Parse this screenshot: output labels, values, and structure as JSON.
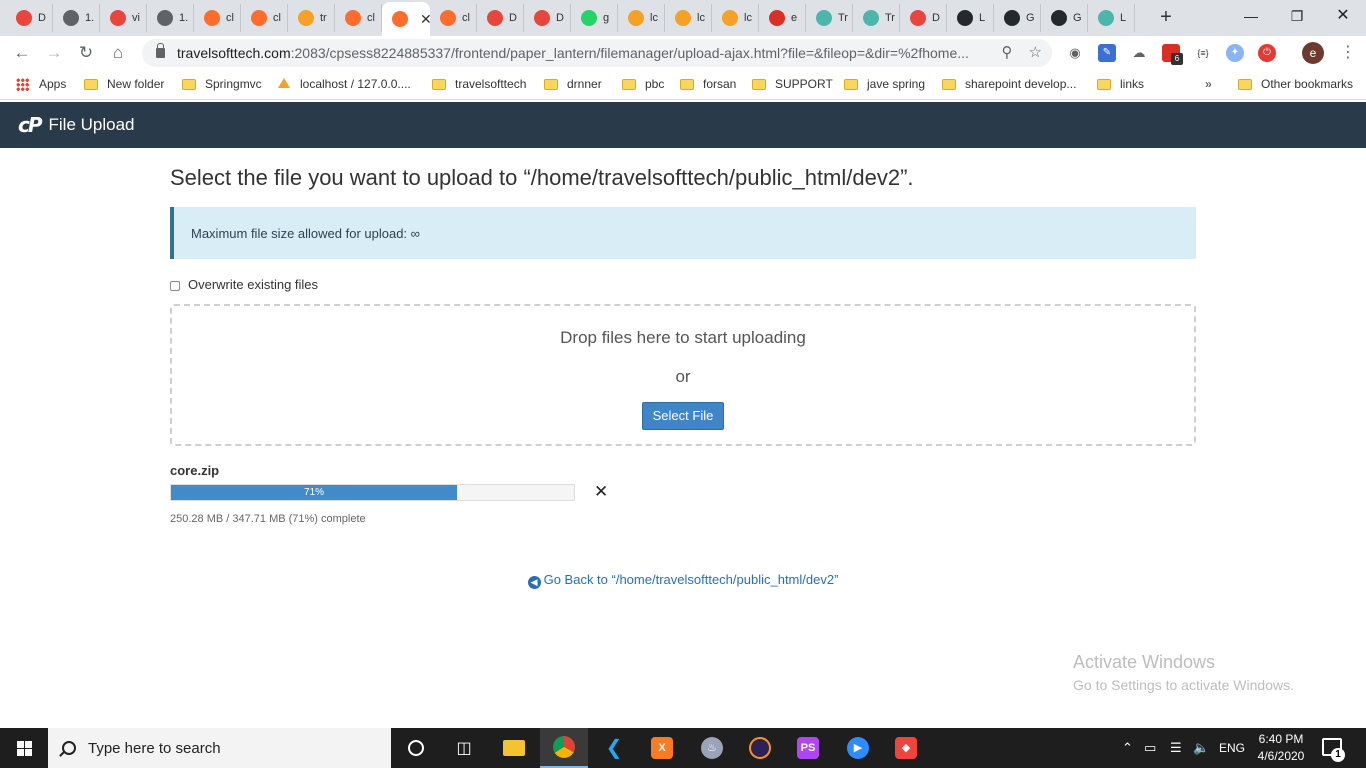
{
  "browser": {
    "tabs": [
      {
        "label": "D",
        "icon": "maps-pin-icon",
        "color": "#e8453c"
      },
      {
        "label": "1.",
        "icon": "globe-icon",
        "color": "#5f6368"
      },
      {
        "label": "vi",
        "icon": "maps-pin-icon",
        "color": "#e8453c"
      },
      {
        "label": "1.",
        "icon": "globe-icon",
        "color": "#5f6368"
      },
      {
        "label": "cl",
        "icon": "cpanel-icon",
        "color": "#ff6c2c"
      },
      {
        "label": "cl",
        "icon": "cpanel-icon",
        "color": "#ff6c2c"
      },
      {
        "label": "tr",
        "icon": "phpmyadmin-icon",
        "color": "#f4a125"
      },
      {
        "label": "cl",
        "icon": "cpanel-icon",
        "color": "#ff6c2c"
      },
      {
        "label": "",
        "icon": "cpanel-icon",
        "color": "#ff6c2c",
        "active": true
      },
      {
        "label": "cl",
        "icon": "cpanel-icon",
        "color": "#ff6c2c"
      },
      {
        "label": "D",
        "icon": "maps-pin-icon",
        "color": "#e8453c"
      },
      {
        "label": "D",
        "icon": "maps-pin-icon",
        "color": "#e8453c"
      },
      {
        "label": "g",
        "icon": "whatsapp-icon",
        "color": "#25d366"
      },
      {
        "label": "lc",
        "icon": "phpmyadmin-icon",
        "color": "#f4a125"
      },
      {
        "label": "lc",
        "icon": "phpmyadmin-icon",
        "color": "#f4a125"
      },
      {
        "label": "lc",
        "icon": "phpmyadmin-icon",
        "color": "#f4a125"
      },
      {
        "label": "e",
        "icon": "gmail-icon",
        "color": "#d93025"
      },
      {
        "label": "Tr",
        "icon": "translate-icon",
        "color": "#4db6ac"
      },
      {
        "label": "Tr",
        "icon": "translate-icon",
        "color": "#4db6ac"
      },
      {
        "label": "D",
        "icon": "maps-pin-icon",
        "color": "#e8453c"
      },
      {
        "label": "L",
        "icon": "github-icon",
        "color": "#24292e"
      },
      {
        "label": "G",
        "icon": "github-icon",
        "color": "#24292e"
      },
      {
        "label": "G",
        "icon": "github-icon",
        "color": "#24292e"
      },
      {
        "label": "L",
        "icon": "translate-icon",
        "color": "#4db6ac"
      }
    ],
    "url_host": "travelsofttech.com",
    "url_rest": ":2083/cpsess8224885337/frontend/paper_lantern/filemanager/upload-ajax.html?file=&fileop=&dir=%2fhome...",
    "profile_initial": "e",
    "ext_badge": "6",
    "ext_json_label": "{≡}",
    "bookmarks": [
      {
        "label": "Apps",
        "type": "apps"
      },
      {
        "label": "New folder",
        "type": "folder"
      },
      {
        "label": "Springmvc",
        "type": "folder"
      },
      {
        "label": "localhost / 127.0.0....",
        "type": "pma"
      },
      {
        "label": "travelsofttech",
        "type": "folder"
      },
      {
        "label": "drnner",
        "type": "folder"
      },
      {
        "label": "pbc",
        "type": "folder"
      },
      {
        "label": "forsan",
        "type": "folder"
      },
      {
        "label": "SUPPORT",
        "type": "folder"
      },
      {
        "label": "jave spring",
        "type": "folder"
      },
      {
        "label": "sharepoint develop...",
        "type": "folder"
      },
      {
        "label": "links",
        "type": "folder"
      }
    ],
    "overflow": "»",
    "other_bookmarks": "Other bookmarks"
  },
  "header": {
    "logo": "cP",
    "title": "File Upload"
  },
  "main": {
    "heading": "Select the file you want to upload to “/home/travelsofttech/public_html/dev2”.",
    "alert": "Maximum file size allowed for upload: ∞",
    "overwrite_label": "Overwrite existing files",
    "drop_text": "Drop files here to start uploading",
    "or_text": "or",
    "select_button": "Select File",
    "upload": {
      "filename": "core.zip",
      "progress_percent": 71,
      "progress_label": "71%",
      "status": "250.28 MB / 347.71 MB (71%) complete",
      "cancel": "✕"
    },
    "go_back": "Go Back to “/home/travelsofttech/public_html/dev2”"
  },
  "watermark": {
    "line1": "Activate Windows",
    "line2": "Go to Settings to activate Windows."
  },
  "taskbar": {
    "search_placeholder": "Type here to search",
    "language": "ENG",
    "time": "6:40 PM",
    "date": "4/6/2020",
    "notification_count": "1"
  }
}
